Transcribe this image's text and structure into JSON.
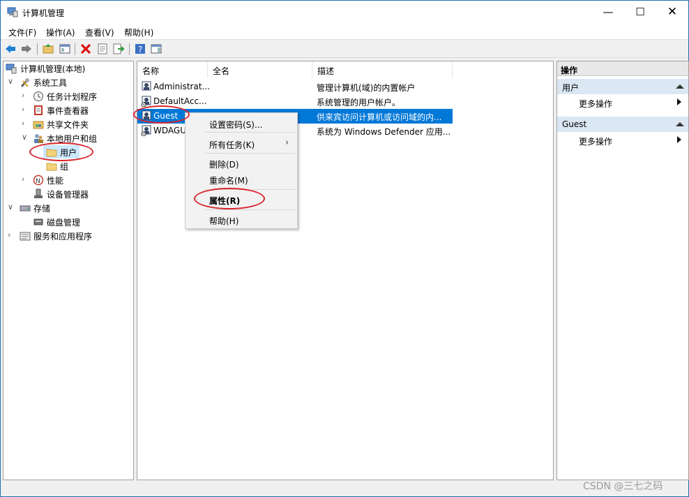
{
  "window": {
    "title": "计算机管理"
  },
  "menubar": {
    "file": "文件(F)",
    "action": "操作(A)",
    "view": "查看(V)",
    "help": "帮助(H)"
  },
  "tree": {
    "root": "计算机管理(本地)",
    "system_tools": "系统工具",
    "task_scheduler": "任务计划程序",
    "event_viewer": "事件查看器",
    "shared_folders": "共享文件夹",
    "local_users_groups": "本地用户和组",
    "users": "用户",
    "groups": "组",
    "performance": "性能",
    "device_manager": "设备管理器",
    "storage": "存储",
    "disk_management": "磁盘管理",
    "services_apps": "服务和应用程序"
  },
  "list": {
    "columns": [
      "名称",
      "全名",
      "描述"
    ],
    "rows": [
      {
        "name": "Administrat...",
        "fullname": "",
        "desc": "管理计算机(域)的内置帐户"
      },
      {
        "name": "DefaultAcc...",
        "fullname": "",
        "desc": "系统管理的用户帐户。"
      },
      {
        "name": "Guest",
        "fullname": "",
        "desc": "供来宾访问计算机或访问域的内..."
      },
      {
        "name": "WDAGU",
        "fullname": "",
        "desc": "系统为 Windows Defender 应用..."
      }
    ]
  },
  "context_menu": {
    "set_password": "设置密码(S)...",
    "all_tasks": "所有任务(K)",
    "delete": "删除(D)",
    "rename": "重命名(M)",
    "properties": "属性(R)",
    "help": "帮助(H)"
  },
  "actions": {
    "title": "操作",
    "section1": "用户",
    "more1": "更多操作",
    "section2": "Guest",
    "more2": "更多操作"
  },
  "watermark": "CSDN @三七之码",
  "colors": {
    "selection": "#0078d7",
    "annotation": "#d9262e",
    "tree_selection": "#cce8ff"
  }
}
